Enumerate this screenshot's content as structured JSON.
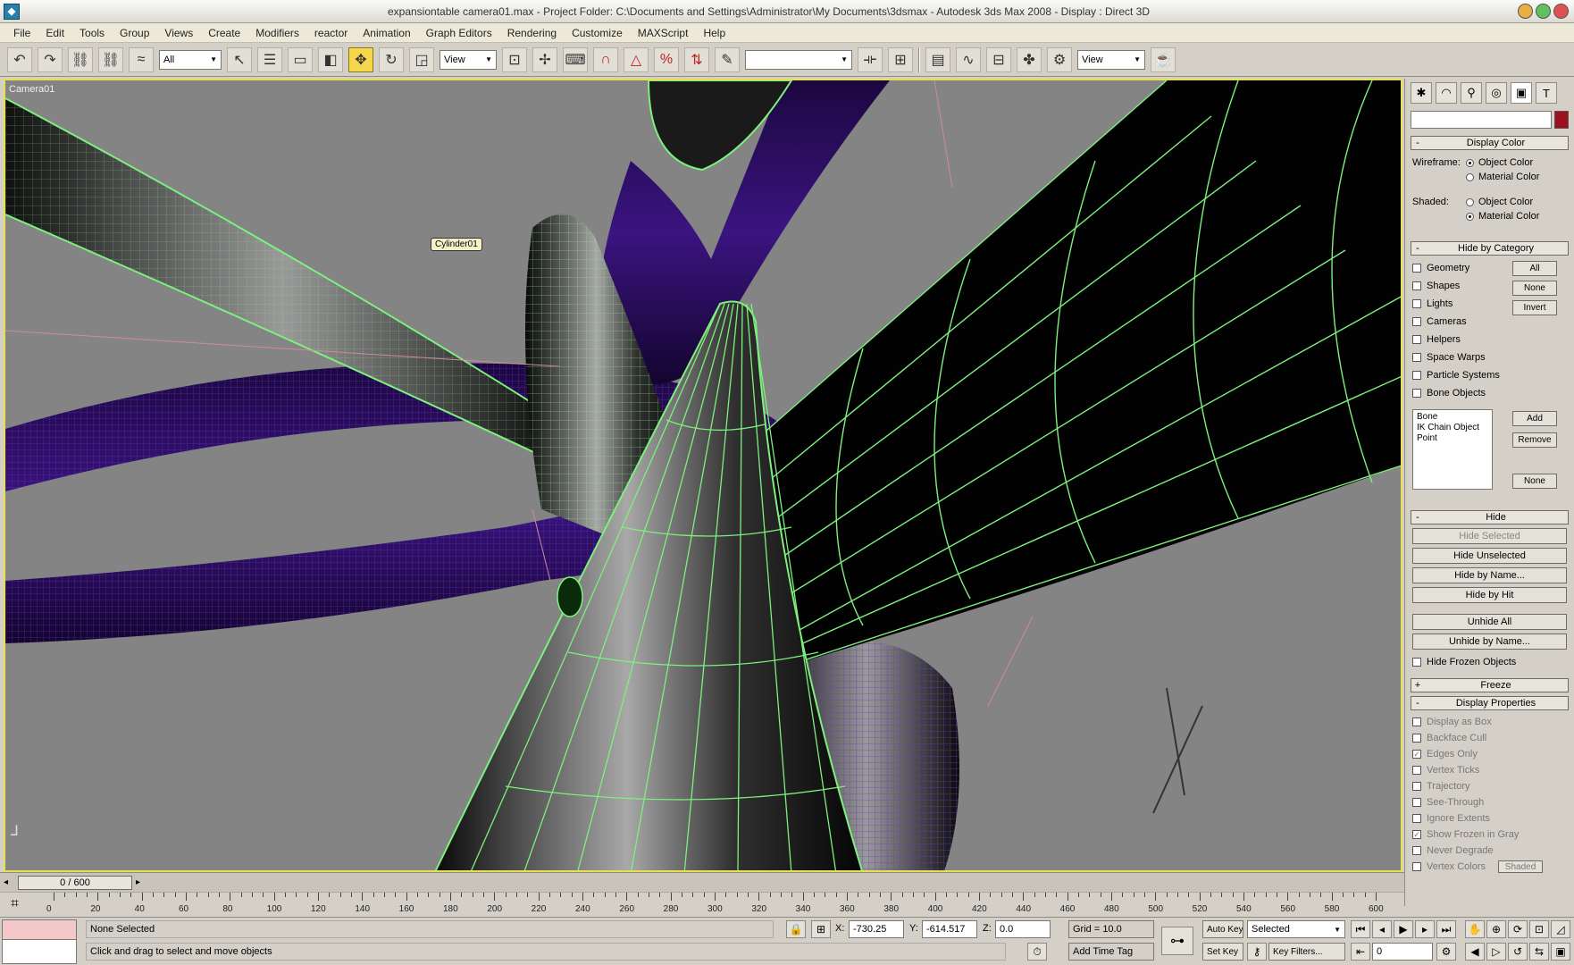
{
  "titlebar": {
    "title": "expansiontable camera01.max    -    Project Folder: C:\\Documents and Settings\\Administrator\\My Documents\\3dsmax    -    Autodesk 3ds Max 2008    -    Display : Direct 3D",
    "icon": "3dsmax-app-icon"
  },
  "menubar": {
    "items": [
      "File",
      "Edit",
      "Tools",
      "Group",
      "Views",
      "Create",
      "Modifiers",
      "reactor",
      "Animation",
      "Graph Editors",
      "Rendering",
      "Customize",
      "MAXScript",
      "Help"
    ]
  },
  "toolbar": {
    "selection_filter": "All",
    "ref_coord": "View",
    "named_selection": "",
    "view_dropdown": "View",
    "active_tool": "select-and-move"
  },
  "viewport": {
    "label": "Camera01",
    "tooltip": "Cylinder01",
    "colors": {
      "background": "#848484",
      "border": "#e8e050",
      "wire_green": "#7df07d",
      "wire_purple": "#6a3ec8",
      "tube_purple": "#2a0d5e"
    }
  },
  "cmdpanel": {
    "tabs": [
      "create-icon",
      "modify-icon",
      "hierarchy-icon",
      "motion-icon",
      "display-icon",
      "utilities-icon"
    ],
    "display_color": {
      "title": "Display Color",
      "wireframe_label": "Wireframe:",
      "shaded_label": "Shaded:",
      "object_color": "Object Color",
      "material_color": "Material Color"
    },
    "hide_by_category": {
      "title": "Hide by Category",
      "items": [
        "Geometry",
        "Shapes",
        "Lights",
        "Cameras",
        "Helpers",
        "Space Warps",
        "Particle Systems",
        "Bone Objects"
      ],
      "all_btn": "All",
      "none_btn": "None",
      "invert_btn": "Invert",
      "add_btn": "Add",
      "remove_btn": "Remove",
      "none_btn2": "None",
      "list": [
        "Bone",
        "IK Chain Object",
        "Point"
      ]
    },
    "hide": {
      "title": "Hide",
      "buttons": [
        "Hide Selected",
        "Hide Unselected",
        "Hide by Name...",
        "Hide by Hit",
        "Unhide All",
        "Unhide by Name..."
      ],
      "hide_frozen": "Hide Frozen Objects"
    },
    "freeze": {
      "title": "Freeze"
    },
    "display_properties": {
      "title": "Display Properties",
      "items": [
        {
          "label": "Display as Box",
          "checked": false
        },
        {
          "label": "Backface Cull",
          "checked": false
        },
        {
          "label": "Edges Only",
          "checked": true
        },
        {
          "label": "Vertex Ticks",
          "checked": false
        },
        {
          "label": "Trajectory",
          "checked": false
        },
        {
          "label": "See-Through",
          "checked": false
        },
        {
          "label": "Ignore Extents",
          "checked": false
        },
        {
          "label": "Show Frozen in Gray",
          "checked": true
        },
        {
          "label": "Never Degrade",
          "checked": false
        },
        {
          "label": "Vertex Colors",
          "checked": false
        }
      ],
      "shaded_btn": "Shaded"
    }
  },
  "timeline": {
    "slider": "0 / 600",
    "ticks": [
      "0",
      "20",
      "40",
      "60",
      "80",
      "100",
      "120",
      "140",
      "160",
      "180",
      "200",
      "220",
      "240",
      "260",
      "280",
      "300",
      "320",
      "340",
      "360",
      "380",
      "400",
      "420",
      "440",
      "460",
      "480",
      "500",
      "520",
      "540",
      "560",
      "580",
      "600"
    ]
  },
  "statusbar": {
    "selection": "None Selected",
    "prompt": "Click and drag to select and move objects",
    "x_label": "X:",
    "x_value": "-730.25",
    "y_label": "Y:",
    "y_value": "-614.517",
    "z_label": "Z:",
    "z_value": "0.0",
    "grid": "Grid = 10.0",
    "add_time_tag": "Add Time Tag",
    "auto_key": "Auto Key",
    "selected": "Selected",
    "set_key": "Set Key",
    "key_filters": "Key Filters...",
    "frame": "0"
  }
}
